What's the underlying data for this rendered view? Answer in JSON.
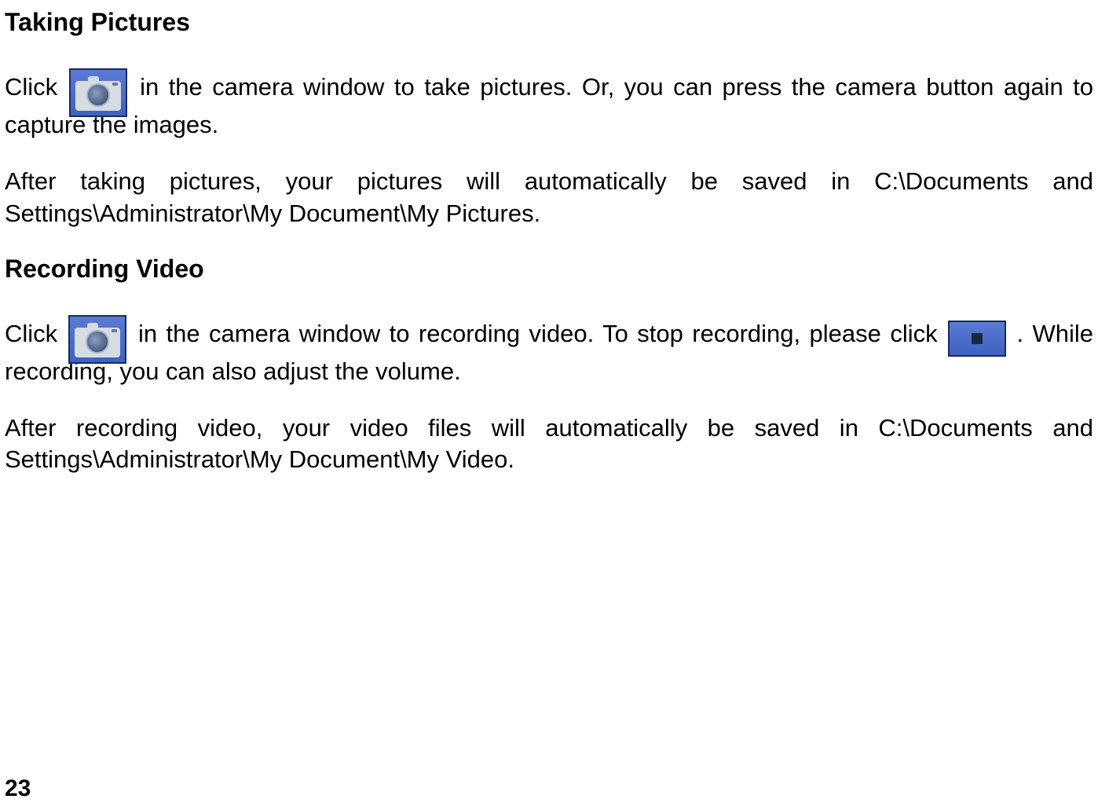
{
  "sections": {
    "taking_pictures": {
      "heading": "Taking Pictures",
      "para1_a": "Click ",
      "para1_b": " in the camera window to take pictures. Or, you can press the camera button again to capture the images.",
      "para2": "After taking pictures, your pictures will automatically be saved in C:\\Documents and Settings\\Administrator\\My Document\\My Pictures."
    },
    "recording_video": {
      "heading": "Recording Video",
      "para1_a": "Click ",
      "para1_b": " in the camera window to recording video. To stop recording, please click ",
      "para1_c": ". While recording, you can also adjust the volume.",
      "para2": "After recording video, your video files will automatically be saved in C:\\Documents and Settings\\Administrator\\My Document\\My Video."
    }
  },
  "page_number": "23"
}
